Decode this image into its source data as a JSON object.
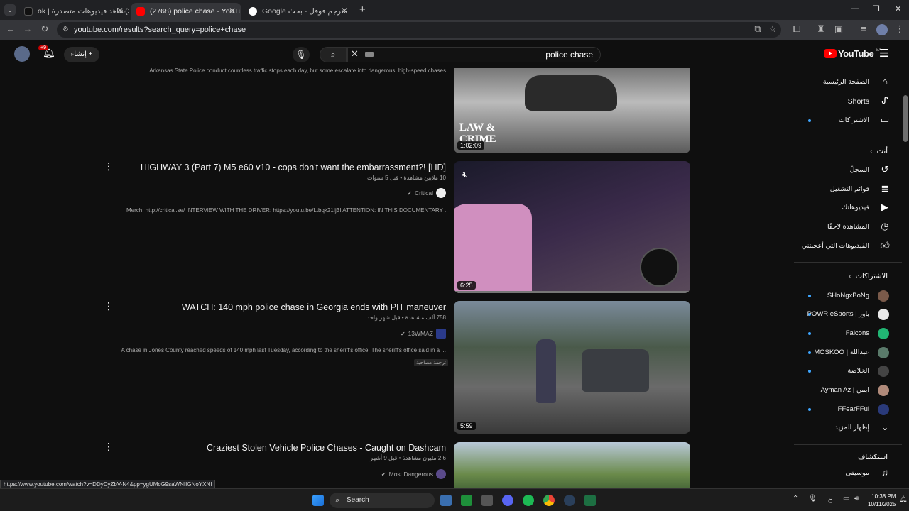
{
  "browser": {
    "tabs": [
      {
        "label": "(33)شاهد فيديوهات متصدرة | ok",
        "active": false
      },
      {
        "label": "(2768) police chase - YouTube",
        "active": true
      },
      {
        "label": "مترجم قوقل - بحث Google",
        "active": false
      }
    ],
    "url": "youtube.com/results?search_query=police+chase"
  },
  "yt_header": {
    "logo": "YouTube",
    "logo_region": "SA",
    "search_query": "police chase",
    "create_label": "إنشاء",
    "notifications_badge": "+9"
  },
  "sidebar": {
    "main_items": [
      {
        "label": "الصفحة الرئيسية",
        "icon": "home-icon"
      },
      {
        "label": "Shorts",
        "icon": "shorts-icon"
      },
      {
        "label": "الاشتراكات",
        "icon": "subscriptions-icon"
      }
    ],
    "you_heading": "أنت",
    "you_items": [
      {
        "label": "السجلّ",
        "icon": "history-icon"
      },
      {
        "label": "قوائم التشغيل",
        "icon": "playlists-icon"
      },
      {
        "label": "فيديوهاتك",
        "icon": "your-videos-icon"
      },
      {
        "label": "المشاهدة لاحقًا",
        "icon": "watch-later-icon"
      },
      {
        "label": "الفيديوهات التي أعجبتني",
        "icon": "liked-icon"
      }
    ],
    "subs_heading": "الاشتراكات",
    "subscriptions": [
      {
        "label": "SHoNgxBoNg",
        "color": "#7a5a4a"
      },
      {
        "label": "POWR eSports | باور",
        "color": "#e8e8e8"
      },
      {
        "label": "Falcons",
        "color": "#21b573"
      },
      {
        "label": "MOSKOO | عبدالله",
        "color": "#5a7a6a"
      },
      {
        "label": "الخلاصة",
        "color": "#444444"
      },
      {
        "label": "Ayman Az | ايمن",
        "color": "#b08a7a"
      },
      {
        "label": "FFearFFul",
        "color": "#2a3a7a"
      }
    ],
    "show_more": "إظهار المزيد",
    "explore_heading": "استكشاف",
    "explore_items": [
      {
        "label": "موسيقى",
        "icon": "music-icon"
      }
    ]
  },
  "results": [
    {
      "title": "",
      "meta": "",
      "channel": "",
      "description": "Arkansas State Police conduct countless traffic stops each day, but some escalate into dangerous, high-speed chases.",
      "duration": "1:02:09",
      "thumb_text": "LAW & CRIME"
    },
    {
      "title": "HIGHWAY 3 (Part 7) M5 e60 v10 - cops don't want the embarrassment?! [HD]",
      "meta": "10 ملايين مشاهدة • قبل 5 سنوات",
      "channel": "Critical",
      "description": "Merch: http://critical.se/ INTERVIEW WITH THE DRIVER: https://youtu.be/Ltbqk21Ij3I ATTENTION: IN THIS DOCUMENTARY ...",
      "duration": "6:25"
    },
    {
      "title": "WATCH: 140 mph police chase in Georgia ends with PIT maneuver",
      "meta": "758 ألف مشاهدة • قبل شهر واحد",
      "channel": "13WMAZ",
      "description": "A chase in Jones County reached speeds of 140 mph last Tuesday, according to the sheriff's office. The sheriff's office said in a ...",
      "badge": "ترجمة مصاحبة",
      "duration": "5:59"
    },
    {
      "title": "Craziest Stolen Vehicle Police Chases - Caught on Dashcam",
      "meta": "2.6 مليون مشاهدة • قبل 9 أشهر",
      "channel": "Most Dangerous",
      "description": "",
      "duration": ""
    }
  ],
  "status_link": "https://www.youtube.com/watch?v=DDyDyZbV-N4&pp=ygUMcG9saWNIIGNoYXNI",
  "taskbar": {
    "search_label": "Search",
    "time": "10:38 PM",
    "date": "10/11/2025",
    "lang": "ع"
  }
}
